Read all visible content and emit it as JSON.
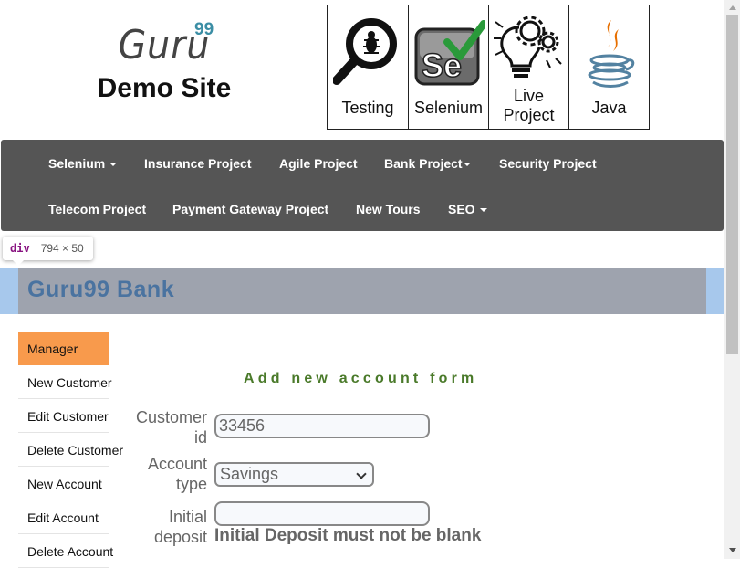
{
  "logo": {
    "brand": "Guru",
    "superscript": "99",
    "subtitle": "Demo Site"
  },
  "tiles": [
    {
      "label_line1": "Testing",
      "label_line2": "",
      "icon": "magnifier-bug-icon"
    },
    {
      "label_line1": "Selenium",
      "label_line2": "",
      "icon": "selenium-icon"
    },
    {
      "label_line1": "Live",
      "label_line2": "Project",
      "icon": "lightbulb-gears-icon"
    },
    {
      "label_line1": "Java",
      "label_line2": "",
      "icon": "java-icon"
    }
  ],
  "nav": {
    "items": [
      {
        "label": "Selenium",
        "dropdown": true
      },
      {
        "label": "Insurance Project",
        "dropdown": false
      },
      {
        "label": "Agile Project",
        "dropdown": false
      },
      {
        "label": "Bank Project",
        "dropdown": true
      },
      {
        "label": "Security Project",
        "dropdown": false
      },
      {
        "label": "Telecom Project",
        "dropdown": false
      },
      {
        "label": "Payment Gateway Project",
        "dropdown": false
      },
      {
        "label": "New Tours",
        "dropdown": false
      },
      {
        "label": "SEO",
        "dropdown": true
      }
    ]
  },
  "tooltip": {
    "tag": "div",
    "dims": "794 × 50"
  },
  "bank": {
    "title": "Guru99 Bank"
  },
  "sidebar": {
    "items": [
      {
        "label": "Manager",
        "active": true
      },
      {
        "label": "New Customer",
        "active": false
      },
      {
        "label": "Edit Customer",
        "active": false
      },
      {
        "label": "Delete Customer",
        "active": false
      },
      {
        "label": "New Account",
        "active": false
      },
      {
        "label": "Edit Account",
        "active": false
      },
      {
        "label": "Delete Account",
        "active": false
      }
    ]
  },
  "form": {
    "title": "Add new account form",
    "customer_id": {
      "label_line1": "Customer",
      "label_line2": "id",
      "value": "33456"
    },
    "account_type": {
      "label_line1": "Account",
      "label_line2": "type",
      "selected": "Savings"
    },
    "initial_deposit": {
      "label_line1": "Initial",
      "label_line2": "deposit",
      "value": "",
      "error": "Initial Deposit must not be blank"
    }
  },
  "colors": {
    "navbar": "#555555",
    "active_sidebar": "#f89a4c",
    "bank_bar": "#9ea3ae",
    "bank_title": "#4a73a0",
    "form_title": "#4a7a2a"
  }
}
